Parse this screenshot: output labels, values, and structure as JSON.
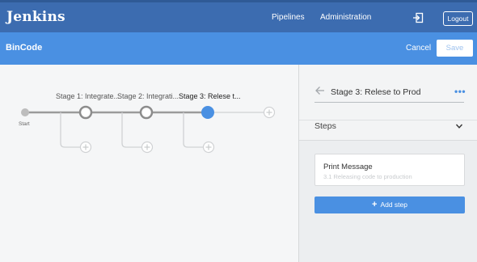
{
  "topbar": {
    "brand": "Jenkins",
    "nav": [
      "Pipelines",
      "Administration"
    ],
    "logout_label": "Logout"
  },
  "header": {
    "pipeline_name": "BinCode",
    "cancel_label": "Cancel",
    "save_label": "Save"
  },
  "graph": {
    "start_label": "Start",
    "stages": [
      {
        "label": "Stage 1: Integrate...",
        "state": "idle"
      },
      {
        "label": "Stage 2: Integrati...",
        "state": "idle"
      },
      {
        "label": "Stage 3: Relese t...",
        "state": "selected"
      }
    ]
  },
  "panel": {
    "stage_title": "Stage 3: Relese to Prod",
    "more_label": "•••",
    "steps_label": "Steps",
    "steps": [
      {
        "name": "Print Message",
        "description": "3.1 Releasing code to production"
      }
    ],
    "add_step_label": "Add step"
  },
  "colors": {
    "topbar": "#3c6cb0",
    "header": "#4a90e2",
    "accent": "#4a90e2"
  }
}
